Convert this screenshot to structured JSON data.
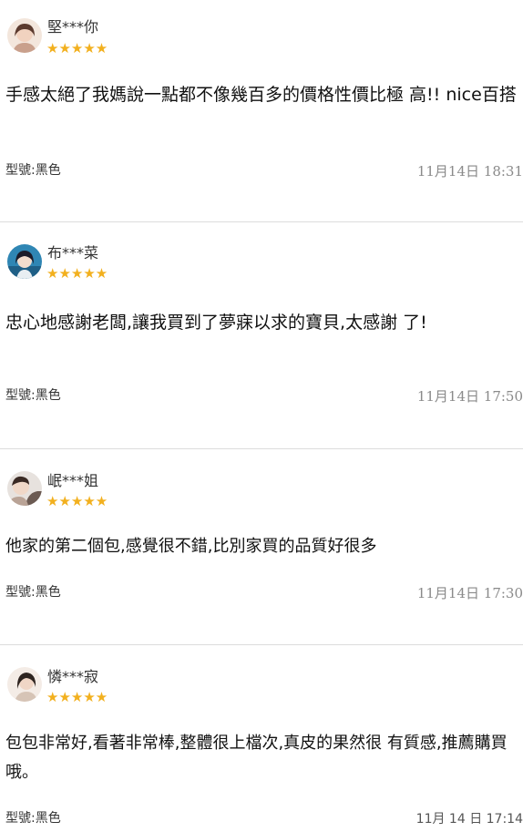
{
  "reviews": [
    {
      "user": "堅***你",
      "stars": "★★★★★",
      "content": "手感太絕了我媽說一點都不像幾百多的價格性價比極 高!! nice百搭",
      "model": "型號:黑色",
      "date": "11月14日 18:31",
      "avatar_icon": "avatar-girl-icon",
      "avatar_color": "#e9c9b8"
    },
    {
      "user": "布***菜",
      "stars": "★★★★★",
      "content": "忠心地感謝老闆,讓我買到了夢寐以求的寶貝,太感謝 了!",
      "model": "型號:黑色",
      "date": "11月14日 17:50",
      "avatar_icon": "avatar-anime-icon",
      "avatar_color": "#3d8fb8"
    },
    {
      "user": "岷***姐",
      "stars": "★★★★★",
      "content": "他家的第二個包,感覺很不錯,比別家買的品質好很多",
      "model": "型號:黑色",
      "date": "11月14日 17:30",
      "avatar_icon": "avatar-person-icon",
      "avatar_color": "#7a6a60"
    },
    {
      "user": "憐***寂",
      "stars": "★★★★★",
      "content": "包包非常好,看著非常棒,整體很上檔次,真皮的果然很 有質感,推薦購買哦。",
      "model": "型號:黑色",
      "date": "11月 14 日 17:14",
      "avatar_icon": "avatar-girl-icon",
      "avatar_color": "#d8c0ae"
    }
  ],
  "colors": {
    "star": "#f2b01e",
    "divider": "#dcdcdc",
    "date": "#8a8a8a"
  }
}
